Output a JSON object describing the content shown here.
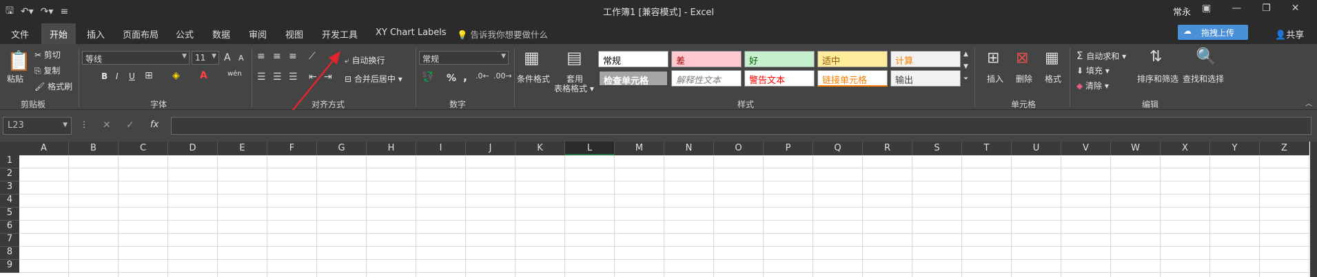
{
  "title_bar": {
    "title": "工作簿1  [兼容模式]  -  Excel",
    "user": "常永"
  },
  "menu": {
    "tabs": [
      "文件",
      "开始",
      "插入",
      "页面布局",
      "公式",
      "数据",
      "审阅",
      "视图",
      "开发工具",
      "XY Chart Labels"
    ],
    "active_tab": "开始",
    "tell_me": "告诉我你想要做什么",
    "upload": "拖拽上传",
    "share": "共享"
  },
  "ribbon": {
    "clipboard": {
      "paste": "粘贴",
      "cut": "剪切",
      "copy": "复制",
      "format_painter": "格式刷",
      "label": "剪贴板"
    },
    "font": {
      "name": "等线",
      "size": "11",
      "bold": "B",
      "italic": "I",
      "underline": "U",
      "font_color": "A",
      "grow": "A",
      "shrink": "A",
      "wen": "wén",
      "label": "字体"
    },
    "alignment": {
      "wrap": "自动换行",
      "merge": "合并后居中",
      "label": "对齐方式"
    },
    "number": {
      "format": "常规",
      "percent": "%",
      "comma": ",",
      "label": "数字"
    },
    "styles": {
      "conditional": "条件格式",
      "table_format_1": "套用",
      "table_format_2": "表格格式",
      "label": "样式",
      "cells": [
        {
          "text": "常规",
          "bg": "#ffffff",
          "fg": "#000000"
        },
        {
          "text": "差",
          "bg": "#ffc7ce",
          "fg": "#9c0006"
        },
        {
          "text": "好",
          "bg": "#c6efce",
          "fg": "#006100"
        },
        {
          "text": "适中",
          "bg": "#ffeb9c",
          "fg": "#9c5700"
        },
        {
          "text": "计算",
          "bg": "#f2f2f2",
          "fg": "#fa7d00"
        },
        {
          "text": "检查单元格",
          "bg": "#a5a5a5",
          "fg": "#ffffff"
        },
        {
          "text": "解释性文本",
          "bg": "#ffffff",
          "fg": "#7f7f7f"
        },
        {
          "text": "警告文本",
          "bg": "#ffffff",
          "fg": "#ff0000"
        },
        {
          "text": "链接单元格",
          "bg": "#ffffff",
          "fg": "#fa7d00"
        },
        {
          "text": "输出",
          "bg": "#f2f2f2",
          "fg": "#3f3f3f"
        }
      ]
    },
    "cells": {
      "insert": "插入",
      "delete": "删除",
      "format": "格式",
      "label": "单元格"
    },
    "editing": {
      "autosum": "自动求和",
      "fill": "填充",
      "clear": "清除",
      "sort": "排序和筛选",
      "find": "查找和选择",
      "label": "编辑"
    }
  },
  "formula_bar": {
    "name_box": "L23",
    "fx": "fx",
    "cancel": "✕",
    "enter": "✓"
  },
  "sheet": {
    "columns": [
      "A",
      "B",
      "C",
      "D",
      "E",
      "F",
      "G",
      "H",
      "I",
      "J",
      "K",
      "L",
      "M",
      "N",
      "O",
      "P",
      "Q",
      "R",
      "S",
      "T",
      "U",
      "V",
      "W",
      "X",
      "Y",
      "Z"
    ],
    "selected_column": "L",
    "rows": [
      "1",
      "2",
      "3",
      "4",
      "5",
      "6",
      "7",
      "8",
      "9"
    ]
  },
  "colors": {
    "accent": "#217346",
    "annotation_arrow": "#e0262c",
    "upload_button": "#4a90d9"
  }
}
